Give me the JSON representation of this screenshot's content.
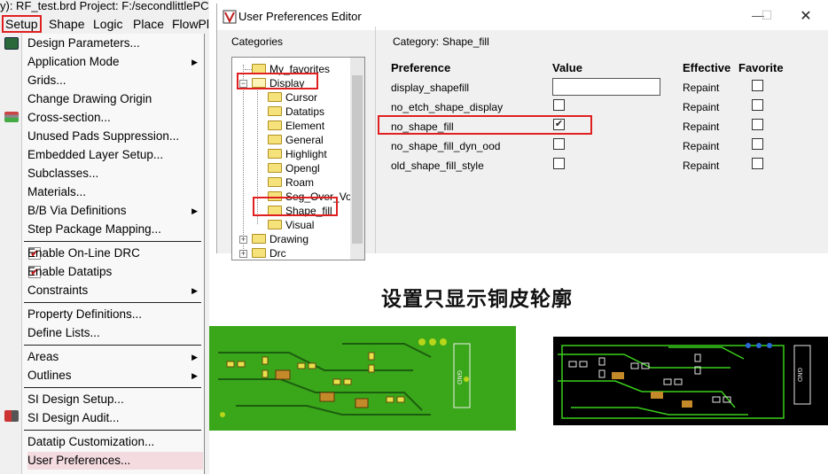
{
  "app": {
    "title_text": "y): RF_test.brd  Project: F:/secondlittlePC",
    "menubar": [
      "Setup",
      "Shape",
      "Logic",
      "Place",
      "FlowPl"
    ]
  },
  "setup_menu": {
    "items": [
      {
        "label": "Design Parameters...",
        "submenu": false
      },
      {
        "label": "Application Mode",
        "submenu": true
      },
      {
        "label": "Grids...",
        "submenu": false
      },
      {
        "label": "Change Drawing Origin",
        "submenu": false
      },
      {
        "label": "Cross-section...",
        "submenu": false
      },
      {
        "label": "Unused Pads Suppression...",
        "submenu": false
      },
      {
        "label": "Embedded Layer Setup...",
        "submenu": false
      },
      {
        "label": "Subclasses...",
        "submenu": false
      },
      {
        "label": "Materials...",
        "submenu": false
      },
      {
        "label": "B/B Via Definitions",
        "submenu": true
      },
      {
        "label": "Step Package Mapping...",
        "submenu": false
      },
      {
        "label": "Enable On-Line DRC",
        "checked": true
      },
      {
        "label": "Enable Datatips",
        "checked": true
      },
      {
        "label": "Constraints",
        "submenu": true
      },
      {
        "label": "Property Definitions...",
        "submenu": false
      },
      {
        "label": "Define Lists...",
        "submenu": false
      },
      {
        "label": "Areas",
        "submenu": true
      },
      {
        "label": "Outlines",
        "submenu": true
      },
      {
        "label": "SI Design Setup...",
        "submenu": false
      },
      {
        "label": "SI Design Audit...",
        "submenu": false
      },
      {
        "label": "Datatip Customization...",
        "submenu": false
      },
      {
        "label": "User Preferences...",
        "submenu": false,
        "highlighted": true
      }
    ]
  },
  "pref_editor": {
    "title": "User Preferences Editor",
    "categories_label": "Categories",
    "category_head": "Category:",
    "category_value": "Shape_fill",
    "tree": [
      {
        "label": "My_favorites",
        "level": 1
      },
      {
        "label": "Display",
        "level": 1,
        "expanded": true
      },
      {
        "label": "Cursor",
        "level": 2
      },
      {
        "label": "Datatips",
        "level": 2
      },
      {
        "label": "Element",
        "level": 2
      },
      {
        "label": "General",
        "level": 2
      },
      {
        "label": "Highlight",
        "level": 2
      },
      {
        "label": "Opengl",
        "level": 2
      },
      {
        "label": "Roam",
        "level": 2
      },
      {
        "label": "Seg_Over_Voi",
        "level": 2
      },
      {
        "label": "Shape_fill",
        "level": 2,
        "selected": true
      },
      {
        "label": "Visual",
        "level": 2
      },
      {
        "label": "Drawing",
        "level": 1,
        "collapsed": true
      },
      {
        "label": "Drc",
        "level": 1,
        "collapsed": true
      }
    ],
    "columns": {
      "preference": "Preference",
      "value": "Value",
      "effective": "Effective",
      "favorite": "Favorite"
    },
    "rows": [
      {
        "name": "display_shapefill",
        "value_type": "text",
        "value": "",
        "effective": "Repaint",
        "favorite": false
      },
      {
        "name": "no_etch_shape_display",
        "value_type": "checkbox",
        "checked": false,
        "effective": "Repaint",
        "favorite": false
      },
      {
        "name": "no_shape_fill",
        "value_type": "checkbox",
        "checked": true,
        "effective": "Repaint",
        "favorite": false
      },
      {
        "name": "no_shape_fill_dyn_ood",
        "value_type": "checkbox",
        "checked": false,
        "effective": "Repaint",
        "favorite": false
      },
      {
        "name": "old_shape_fill_style",
        "value_type": "checkbox",
        "checked": false,
        "effective": "Repaint",
        "favorite": false
      }
    ]
  },
  "caption": "设置只显示铜皮轮廓",
  "pcb": {
    "green_label": "GND",
    "black_label": "GND"
  },
  "colors": {
    "highlight_red": "#e02020",
    "pcb_green_bg": "#3aa619",
    "pcb_black_bg": "#000000",
    "menu_hover": "#f3dbe0"
  }
}
